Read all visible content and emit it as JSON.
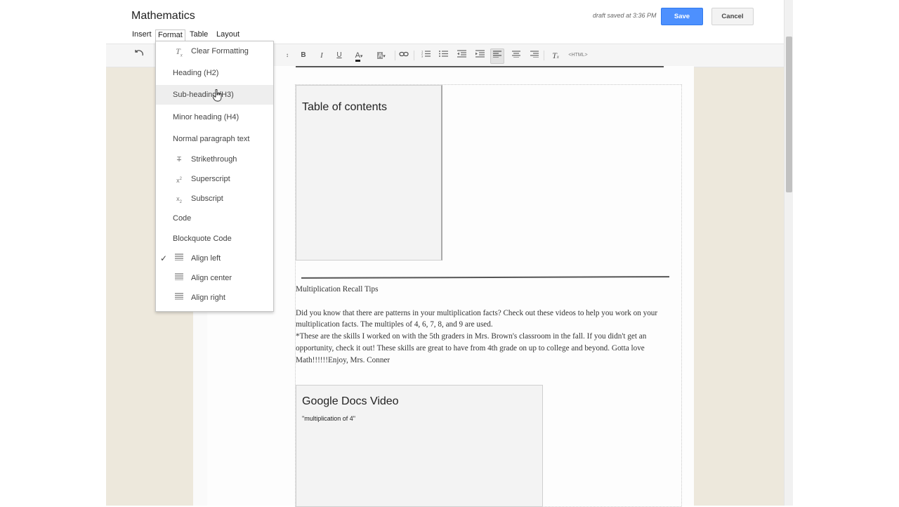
{
  "header": {
    "title": "Mathematics",
    "draft_status": "draft saved at 3:36 PM",
    "save_label": "Save",
    "cancel_label": "Cancel"
  },
  "menubar": {
    "items": [
      "Insert",
      "Format",
      "Table",
      "Layout"
    ],
    "active": "Format"
  },
  "toolbar": {
    "undo_icon": "undo-icon",
    "bold": "B",
    "italic": "I",
    "underline": "U",
    "text_color": "A",
    "highlight": "A",
    "html": "<HTML>",
    "active_alignment": "align-left"
  },
  "format_menu": {
    "items": [
      {
        "label": "Clear Formatting",
        "icon": "clear-formatting-icon"
      },
      {
        "label": "Heading (H2)"
      },
      {
        "label": "Sub-heading (H3)",
        "hover": true
      },
      {
        "label": "Minor heading (H4)"
      },
      {
        "label": "Normal paragraph text"
      },
      {
        "label": "Strikethrough",
        "icon": "strikethrough-icon"
      },
      {
        "label": "Superscript",
        "icon": "superscript-icon"
      },
      {
        "label": "Subscript",
        "icon": "subscript-icon"
      },
      {
        "label": "Code"
      },
      {
        "label": "Blockquote Code"
      },
      {
        "label": "Align left",
        "icon": "align-left-icon",
        "checked": true
      },
      {
        "label": "Align center",
        "icon": "align-center-icon"
      },
      {
        "label": "Align right",
        "icon": "align-right-icon"
      }
    ]
  },
  "page": {
    "toc_title": "Table of contents",
    "article_heading": "Multiplication Recall Tips",
    "paragraph1": "Did you know that there are patterns in your multiplication facts? Check out these videos to help you work on your multiplication facts. The multiples of 4, 6, 7, 8, and 9 are used.",
    "paragraph2": "*These are the skills I worked on with the 5th graders in Mrs. Brown's classroom in the fall. If you didn't get an opportunity, check it out! These skills are great to have from 4th grade on up to college and beyond. Gotta love Math!!!!!!Enjoy, Mrs. Conner",
    "video_title": "Google Docs Video",
    "video_caption": "\"multiplication of 4\""
  },
  "colors": {
    "save_button": "#4d90fe",
    "background": "#ede8dc",
    "link": "#4a90d9"
  }
}
